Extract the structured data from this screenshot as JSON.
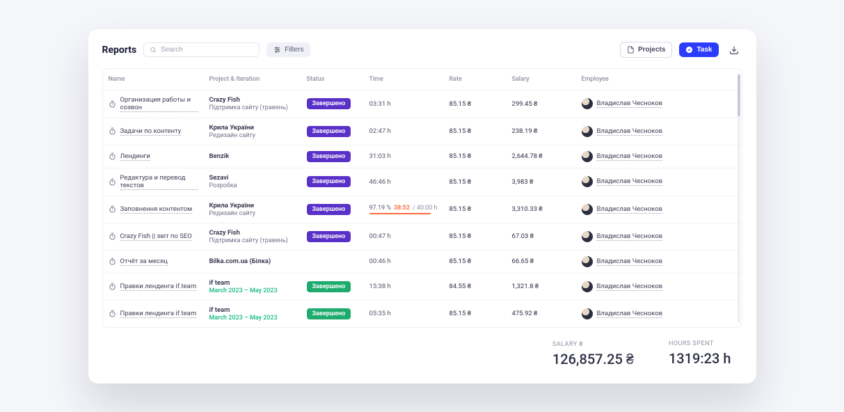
{
  "header": {
    "title": "Reports",
    "search_placeholder": "Search",
    "filters_label": "Filters",
    "projects_label": "Projects",
    "task_label": "Task"
  },
  "columns": {
    "name": "Name",
    "project": "Project & Iteration",
    "status": "Status",
    "time": "Time",
    "rate": "Rate",
    "salary": "Salary",
    "employee": "Employee"
  },
  "status_labels": {
    "done": "Завершено"
  },
  "rows": [
    {
      "name": "Организация работы и созвон",
      "project": "Crazy Fish",
      "iteration": "Підтримка сайту (травень)",
      "status": "done",
      "status_color": "purple",
      "time": "03:31 h",
      "rate": "85.15 ₴",
      "salary": "299.45 ₴",
      "employee": "Владислав Чесноков"
    },
    {
      "name": "Задачи по контенту",
      "project": "Крила України",
      "iteration": "Редизайн сайту",
      "status": "done",
      "status_color": "purple",
      "time": "02:47 h",
      "rate": "85.15 ₴",
      "salary": "238.19 ₴",
      "employee": "Владислав Чесноков"
    },
    {
      "name": "Лендинги",
      "project": "Benzik",
      "iteration": "",
      "status": "done",
      "status_color": "purple",
      "time": "31:03 h",
      "rate": "85.15 ₴",
      "salary": "2,644.78 ₴",
      "employee": "Владислав Чесноков"
    },
    {
      "name": "Редактура и перевод текстов",
      "project": "Sezavi",
      "iteration": "Розробка",
      "status": "done",
      "status_color": "purple",
      "time": "46:46 h",
      "rate": "85.15 ₴",
      "salary": "3,983 ₴",
      "employee": "Владислав Чесноков"
    },
    {
      "name": "Заповнення контентом",
      "project": "Крила України",
      "iteration": "Редизайн сайту",
      "status": "done",
      "status_color": "purple",
      "time_fancy": {
        "pct": "97.19 %",
        "over": "38:52",
        "target": "/ 40:00 h"
      },
      "rate": "85.15 ₴",
      "salary": "3,310.33 ₴",
      "employee": "Владислав Чесноков"
    },
    {
      "name": "Crazy Fish || звіт по SEO",
      "project": "Crazy Fish",
      "iteration": "Підтримка сайту (травень)",
      "status": "done",
      "status_color": "purple",
      "time": "00:47 h",
      "rate": "85.15 ₴",
      "salary": "67.03 ₴",
      "employee": "Владислав Чесноков"
    },
    {
      "name": "Отчёт за месяц",
      "project": "Bilka.com.ua (Білка)",
      "iteration": "",
      "status": "",
      "status_color": "",
      "time": "00:46 h",
      "rate": "85.15 ₴",
      "salary": "66.65 ₴",
      "employee": "Владислав Чесноков"
    },
    {
      "name": "Правки лендинга if.team",
      "project": "if team",
      "iteration": "March 2023 – May 2023",
      "iteration_green": true,
      "status": "done",
      "status_color": "green",
      "time": "15:38 h",
      "rate": "84.55 ₴",
      "salary": "1,321.8 ₴",
      "employee": "Владислав Чесноков"
    },
    {
      "name": "Правки лендинга if.team",
      "project": "if team",
      "iteration": "March 2023 – May 2023",
      "iteration_green": true,
      "status": "done",
      "status_color": "green",
      "time": "05:35 h",
      "rate": "85.15 ₴",
      "salary": "475.92 ₴",
      "employee": "Владислав Чесноков"
    }
  ],
  "summary": {
    "salary_label": "SALARY ₴",
    "salary_value": "126,857.25 ₴",
    "hours_label": "HOURS SPENT",
    "hours_value": "1319:23 h"
  }
}
